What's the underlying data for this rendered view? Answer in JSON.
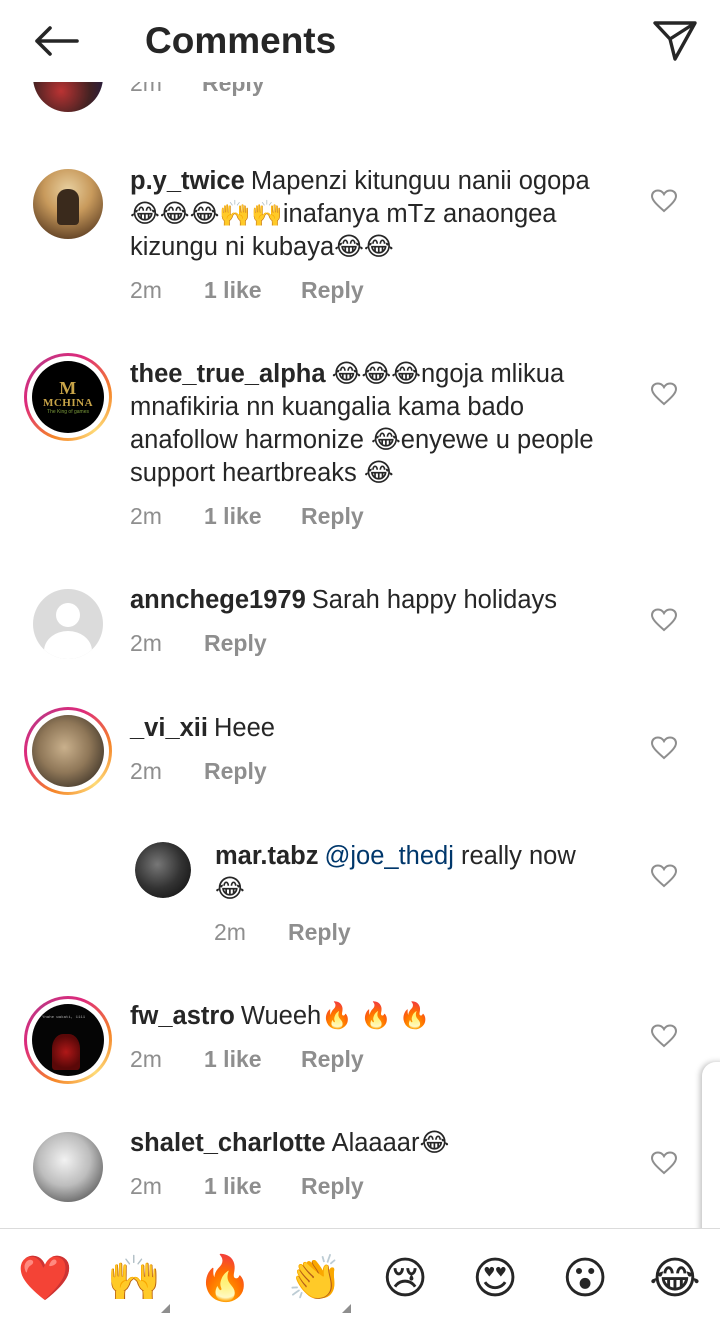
{
  "header": {
    "title": "Comments",
    "back_icon": "arrow-left-icon",
    "send_icon": "paper-plane-icon"
  },
  "previous_comment": {
    "time": "2m",
    "reply_label": "Reply"
  },
  "comments": [
    {
      "username": "p.y_twice",
      "text": "Mapenzi kitunguu nanii ogopa 😂😂😂🙌🙌inafanya mTz anaongea kizungu ni kubaya😂😂",
      "time": "2m",
      "likes": "1 like",
      "reply_label": "Reply"
    },
    {
      "username": "thee_true_alpha",
      "text": "😂😂😂ngoja mlikua mnafikiria nn kuangalia kama bado anafollow harmonize 😂enyewe u people support heartbreaks 😂",
      "time": "2m",
      "likes": "1 like",
      "reply_label": "Reply",
      "avatar_text": {
        "mark": "M",
        "name": "MCHINA",
        "sub": "The King of games"
      }
    },
    {
      "username": "annchege1979",
      "text": "Sarah happy holidays",
      "time": "2m",
      "reply_label": "Reply"
    },
    {
      "username": "_vi_xii",
      "text": "Heee",
      "time": "2m",
      "reply_label": "Reply"
    },
    {
      "username": "mar.tabz",
      "mention": "@joe_thedj",
      "text": "really now",
      "text2": "😂",
      "time": "2m",
      "reply_label": "Reply"
    },
    {
      "username": "fw_astro",
      "text": "Wueeh🔥 🔥 🔥",
      "time": "2m",
      "likes": "1 like",
      "reply_label": "Reply",
      "avatar_text": "Ynahe wakati, 1111"
    },
    {
      "username": "shalet_charlotte",
      "text": "Alaaaar😂",
      "time": "2m",
      "likes": "1 like",
      "reply_label": "Reply"
    }
  ],
  "emoji_bar": [
    "❤️",
    "🙌",
    "🔥",
    "👏",
    "😢",
    "😍",
    "😮",
    "😂"
  ],
  "colors": {
    "text": "#262626",
    "secondary": "#8e8e8e",
    "mention": "#00376b",
    "divider": "#dbdbdb"
  }
}
